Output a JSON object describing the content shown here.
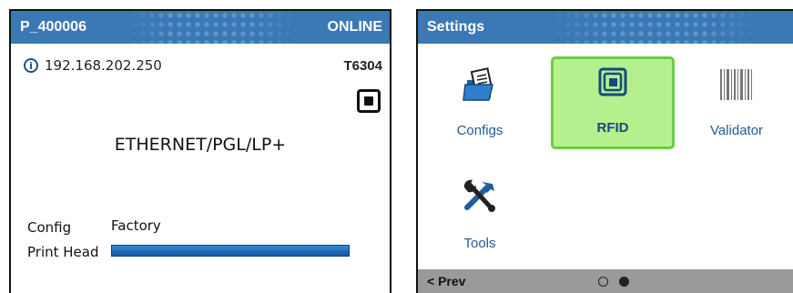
{
  "printer_status": {
    "printer_name": "P_400006",
    "status": "ONLINE",
    "ip_address": "192.168.202.250",
    "model": "T6304",
    "protocol": "ETHERNET/PGL/LP+",
    "config_label": "Config",
    "config_value": "Factory",
    "print_head_label": "Print Head",
    "print_head_level": 1.0
  },
  "settings_menu": {
    "title": "Settings",
    "items": [
      {
        "label": "Configs",
        "icon": "folder-document-icon",
        "selected": false
      },
      {
        "label": "RFID",
        "icon": "rfid-chip-icon",
        "selected": true
      },
      {
        "label": "Validator",
        "icon": "barcode-icon",
        "selected": false
      },
      {
        "label": "Tools",
        "icon": "tools-icon",
        "selected": false
      }
    ],
    "prev_label": "< Prev",
    "page_indicator": {
      "current": 2,
      "total": 2
    }
  },
  "colors": {
    "title_bar": "#3b78b6",
    "selection": "#b5f08e",
    "selection_border": "#6fca46",
    "progress": "#1c66b5",
    "bottom_bar": "#9a9a9a"
  }
}
